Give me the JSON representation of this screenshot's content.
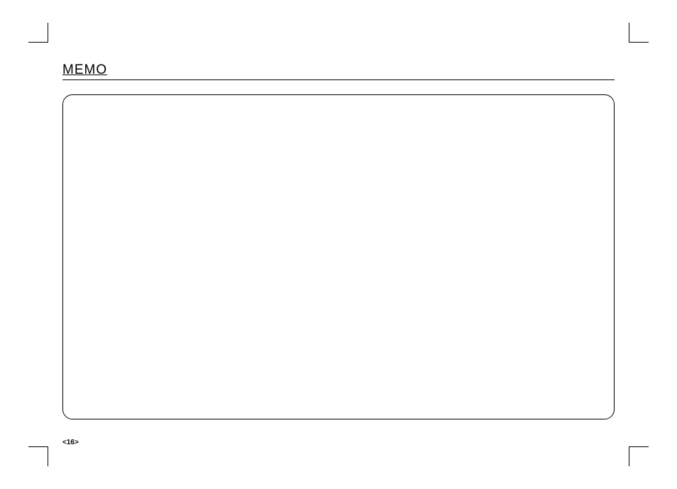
{
  "header": {
    "title": "MEMO"
  },
  "footer": {
    "page_number": "<16>"
  }
}
